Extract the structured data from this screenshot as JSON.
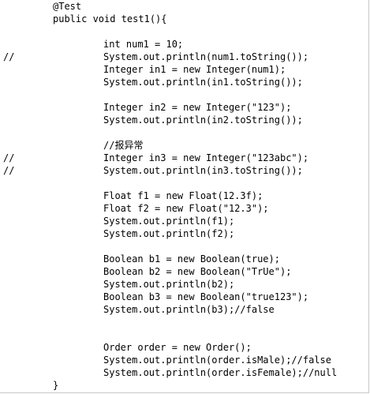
{
  "editor": {
    "lines": [
      {
        "comment": "",
        "text": "@Test",
        "indent": 1
      },
      {
        "comment": "",
        "text": "public void test1(){",
        "indent": 1
      },
      {
        "comment": "",
        "text": "",
        "indent": 0
      },
      {
        "comment": "",
        "text": "int num1 = 10;",
        "indent": 2
      },
      {
        "comment": "//",
        "text": "System.out.println(num1.toString());",
        "indent": 2
      },
      {
        "comment": "",
        "text": "Integer in1 = new Integer(num1);",
        "indent": 2
      },
      {
        "comment": "",
        "text": "System.out.println(in1.toString());",
        "indent": 2
      },
      {
        "comment": "",
        "text": "",
        "indent": 0
      },
      {
        "comment": "",
        "text": "Integer in2 = new Integer(\"123\");",
        "indent": 2
      },
      {
        "comment": "",
        "text": "System.out.println(in2.toString());",
        "indent": 2
      },
      {
        "comment": "",
        "text": "",
        "indent": 0
      },
      {
        "comment": "",
        "text": "//报异常",
        "indent": 2
      },
      {
        "comment": "//",
        "text": "Integer in3 = new Integer(\"123abc\");",
        "indent": 2
      },
      {
        "comment": "//",
        "text": "System.out.println(in3.toString());",
        "indent": 2
      },
      {
        "comment": "",
        "text": "",
        "indent": 0
      },
      {
        "comment": "",
        "text": "Float f1 = new Float(12.3f);",
        "indent": 2
      },
      {
        "comment": "",
        "text": "Float f2 = new Float(\"12.3\");",
        "indent": 2
      },
      {
        "comment": "",
        "text": "System.out.println(f1);",
        "indent": 2
      },
      {
        "comment": "",
        "text": "System.out.println(f2);",
        "indent": 2
      },
      {
        "comment": "",
        "text": "",
        "indent": 0
      },
      {
        "comment": "",
        "text": "Boolean b1 = new Boolean(true);",
        "indent": 2
      },
      {
        "comment": "",
        "text": "Boolean b2 = new Boolean(\"TrUe\");",
        "indent": 2
      },
      {
        "comment": "",
        "text": "System.out.println(b2);",
        "indent": 2
      },
      {
        "comment": "",
        "text": "Boolean b3 = new Boolean(\"true123\");",
        "indent": 2
      },
      {
        "comment": "",
        "text": "System.out.println(b3);//false",
        "indent": 2
      },
      {
        "comment": "",
        "text": "",
        "indent": 0
      },
      {
        "comment": "",
        "text": "",
        "indent": 0
      },
      {
        "comment": "",
        "text": "Order order = new Order();",
        "indent": 2
      },
      {
        "comment": "",
        "text": "System.out.println(order.isMale);//false",
        "indent": 2
      },
      {
        "comment": "",
        "text": "System.out.println(order.isFemale);//null",
        "indent": 2
      },
      {
        "comment": "",
        "text": "}",
        "indent": 1
      }
    ]
  }
}
